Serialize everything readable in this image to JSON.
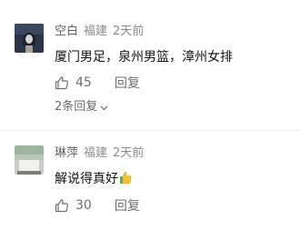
{
  "comments": [
    {
      "username": "空白",
      "location": "福建",
      "time": "2天前",
      "text": "厦门男足，泉州男篮，漳州女排",
      "likes": "45",
      "reply_label": "回复",
      "more_replies": "2条回复"
    },
    {
      "username": "琳萍",
      "location": "福建",
      "time": "2天前",
      "text": "解说得真好",
      "likes": "30",
      "reply_label": "回复"
    }
  ],
  "icons": {
    "like": "thumbs-up-outline-icon",
    "chevron": "chevron-down-icon",
    "emoji": "thumbs-up-emoji-icon"
  },
  "colors": {
    "text_primary": "#111111",
    "text_secondary": "#8a8a8a",
    "emoji_yellow": "#f2c23a",
    "emoji_green": "#6aa84f"
  }
}
